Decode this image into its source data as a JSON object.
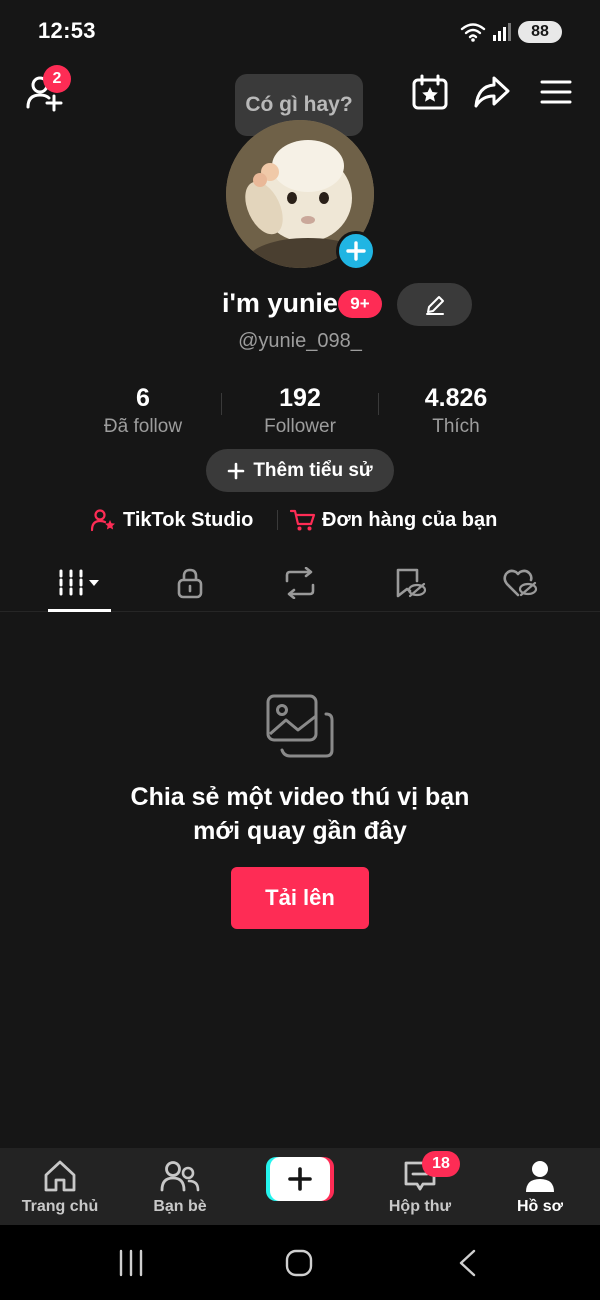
{
  "status_bar": {
    "time": "12:53",
    "battery": "88"
  },
  "header": {
    "friend_requests_badge": "2"
  },
  "tooltip": {
    "text": "Có gì hay?"
  },
  "profile": {
    "name": "i'm yunie",
    "level_badge": "9+",
    "handle": "@yunie_098_"
  },
  "stats": [
    {
      "value": "6",
      "label": "Đã follow"
    },
    {
      "value": "192",
      "label": "Follower"
    },
    {
      "value": "4.826",
      "label": "Thích"
    }
  ],
  "bio_button": {
    "label": "Thêm tiểu sử"
  },
  "links": {
    "studio": "TikTok Studio",
    "orders": "Đơn hàng của bạn"
  },
  "empty_state": {
    "line1": "Chia sẻ một video thú vị bạn",
    "line2": "mới quay gần đây",
    "upload": "Tải lên"
  },
  "bottom_nav": {
    "home": "Trang chủ",
    "friends": "Bạn bè",
    "inbox": "Hộp thư",
    "inbox_badge": "18",
    "profile": "Hồ sơ"
  },
  "colors": {
    "accent": "#fe2c55",
    "background": "#161616",
    "avatar_add": "#20b5e3"
  }
}
